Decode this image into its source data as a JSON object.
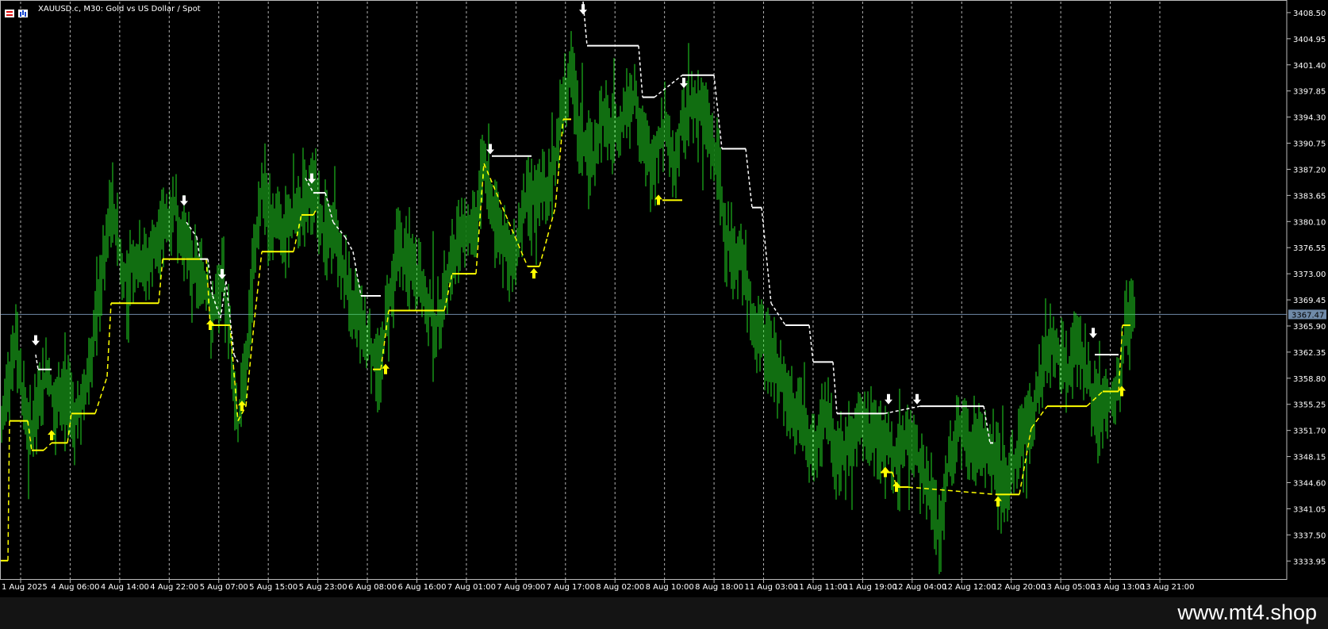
{
  "header": {
    "symbol": "XAUUSD.c, M30:",
    "description": "Gold vs US Dollar / Spot"
  },
  "watermark": "www.mt4.shop",
  "colors": {
    "background": "#000000",
    "candle": "#22dd22",
    "up_signal": "#ffff00",
    "down_signal": "#ffffff",
    "bid_line": "#6f8aa8",
    "grid": "#cfcfcf"
  },
  "chart_data": {
    "type": "bar",
    "title": "",
    "symbol": "XAUUSD.c",
    "timeframe": "M30",
    "ylim": [
      3331.5,
      3410.0
    ],
    "y_ticks": [
      "3408.50",
      "3404.95",
      "3401.40",
      "3397.85",
      "3394.30",
      "3390.75",
      "3387.20",
      "3383.65",
      "3380.10",
      "3376.55",
      "3373.00",
      "3369.45",
      "3365.90",
      "3362.35",
      "3358.80",
      "3355.25",
      "3351.70",
      "3348.15",
      "3344.60",
      "3341.05",
      "3337.50",
      "3333.95"
    ],
    "x_ticks": [
      "1 Aug 2025",
      "4 Aug 06:00",
      "4 Aug 14:00",
      "4 Aug 22:00",
      "5 Aug 07:00",
      "5 Aug 15:00",
      "5 Aug 23:00",
      "6 Aug 08:00",
      "6 Aug 16:00",
      "7 Aug 01:00",
      "7 Aug 09:00",
      "7 Aug 17:00",
      "8 Aug 02:00",
      "8 Aug 10:00",
      "8 Aug 18:00",
      "11 Aug 03:00",
      "11 Aug 11:00",
      "11 Aug 19:00",
      "12 Aug 04:00",
      "12 Aug 12:00",
      "12 Aug 20:00",
      "13 Aug 05:00",
      "13 Aug 13:00",
      "13 Aug 21:00"
    ],
    "current_price": "3367.47",
    "grid": "vertical dashed",
    "close_path": [
      [
        0,
        3350
      ],
      [
        10,
        3358
      ],
      [
        20,
        3364
      ],
      [
        30,
        3355
      ],
      [
        40,
        3352
      ],
      [
        50,
        3356
      ],
      [
        60,
        3360
      ],
      [
        70,
        3354
      ],
      [
        80,
        3358
      ],
      [
        95,
        3354
      ],
      [
        110,
        3358
      ],
      [
        125,
        3370
      ],
      [
        140,
        3384
      ],
      [
        155,
        3373
      ],
      [
        170,
        3375
      ],
      [
        185,
        3374
      ],
      [
        200,
        3378
      ],
      [
        210,
        3380
      ],
      [
        220,
        3382
      ],
      [
        230,
        3378
      ],
      [
        240,
        3375
      ],
      [
        255,
        3372
      ],
      [
        270,
        3368
      ],
      [
        280,
        3372
      ],
      [
        290,
        3365
      ],
      [
        300,
        3352
      ],
      [
        310,
        3360
      ],
      [
        320,
        3375
      ],
      [
        330,
        3385
      ],
      [
        340,
        3381
      ],
      [
        360,
        3379
      ],
      [
        380,
        3381
      ],
      [
        395,
        3384
      ],
      [
        410,
        3378
      ],
      [
        425,
        3377
      ],
      [
        440,
        3371
      ],
      [
        455,
        3366
      ],
      [
        470,
        3362
      ],
      [
        480,
        3360
      ],
      [
        490,
        3370
      ],
      [
        500,
        3377
      ],
      [
        515,
        3374
      ],
      [
        530,
        3372
      ],
      [
        550,
        3366
      ],
      [
        560,
        3370
      ],
      [
        575,
        3377
      ],
      [
        590,
        3379
      ],
      [
        600,
        3378
      ],
      [
        610,
        3388
      ],
      [
        620,
        3382
      ],
      [
        630,
        3378
      ],
      [
        645,
        3374
      ],
      [
        655,
        3379
      ],
      [
        665,
        3383
      ],
      [
        675,
        3384
      ],
      [
        690,
        3385
      ],
      [
        700,
        3389
      ],
      [
        710,
        3397
      ],
      [
        720,
        3400
      ],
      [
        730,
        3392
      ],
      [
        740,
        3390
      ],
      [
        750,
        3388
      ],
      [
        760,
        3395
      ],
      [
        770,
        3392
      ],
      [
        785,
        3394
      ],
      [
        800,
        3397
      ],
      [
        810,
        3392
      ],
      [
        820,
        3387
      ],
      [
        830,
        3391
      ],
      [
        840,
        3394
      ],
      [
        850,
        3388
      ],
      [
        860,
        3394
      ],
      [
        875,
        3396
      ],
      [
        890,
        3394
      ],
      [
        905,
        3388
      ],
      [
        915,
        3378
      ],
      [
        925,
        3376
      ],
      [
        940,
        3374
      ],
      [
        950,
        3365
      ],
      [
        965,
        3363
      ],
      [
        980,
        3361
      ],
      [
        995,
        3355
      ],
      [
        1010,
        3353
      ],
      [
        1025,
        3349
      ],
      [
        1040,
        3355
      ],
      [
        1055,
        3348
      ],
      [
        1070,
        3350
      ],
      [
        1085,
        3352
      ],
      [
        1100,
        3351
      ],
      [
        1115,
        3350
      ],
      [
        1130,
        3348
      ],
      [
        1145,
        3351
      ],
      [
        1160,
        3347
      ],
      [
        1175,
        3343
      ],
      [
        1185,
        3336
      ],
      [
        1195,
        3347
      ],
      [
        1210,
        3352
      ],
      [
        1225,
        3349
      ],
      [
        1240,
        3350
      ],
      [
        1255,
        3348
      ],
      [
        1270,
        3344
      ],
      [
        1285,
        3350
      ],
      [
        1300,
        3353
      ],
      [
        1315,
        3361
      ],
      [
        1330,
        3364
      ],
      [
        1345,
        3359
      ],
      [
        1360,
        3364
      ],
      [
        1375,
        3357
      ],
      [
        1385,
        3354
      ],
      [
        1395,
        3356
      ],
      [
        1410,
        3357
      ],
      [
        1420,
        3367
      ],
      [
        1430,
        3368
      ]
    ],
    "series": [
      {
        "values": [
          [
            0,
            3334
          ],
          [
            10,
            3334
          ],
          [
            12,
            3353
          ],
          [
            35,
            3353
          ],
          [
            40,
            3349
          ],
          [
            55,
            3349
          ],
          [
            65,
            3350
          ],
          [
            85,
            3350
          ],
          [
            90,
            3354
          ],
          [
            120,
            3354
          ],
          [
            135,
            3359
          ],
          [
            140,
            3369
          ],
          [
            200,
            3369
          ],
          [
            205,
            3375
          ],
          [
            260,
            3375
          ],
          [
            265,
            3366
          ],
          [
            290,
            3366
          ],
          [
            300,
            3353
          ],
          [
            310,
            3355
          ],
          [
            320,
            3366
          ],
          [
            330,
            3376
          ],
          [
            370,
            3376
          ],
          [
            380,
            3381
          ],
          [
            395,
            3381
          ],
          [
            400,
            3382
          ],
          [
            470,
            3360
          ],
          [
            480,
            3360
          ],
          [
            490,
            3368
          ],
          [
            560,
            3368
          ],
          [
            570,
            3373
          ],
          [
            600,
            3373
          ],
          [
            610,
            3388
          ],
          [
            665,
            3374
          ],
          [
            680,
            3374
          ],
          [
            690,
            3378
          ],
          [
            700,
            3382
          ],
          [
            710,
            3394
          ],
          [
            720,
            3394
          ],
          [
            835,
            3383
          ],
          [
            860,
            3383
          ],
          [
            1110,
            3346
          ],
          [
            1125,
            3346
          ],
          [
            1130,
            3344
          ],
          [
            1145,
            3344
          ],
          [
            1255,
            3343
          ],
          [
            1285,
            3343
          ],
          [
            1300,
            3352
          ],
          [
            1320,
            3355
          ],
          [
            1370,
            3355
          ],
          [
            1390,
            3357
          ],
          [
            1410,
            3357
          ],
          [
            1415,
            3366
          ],
          [
            1425,
            3366
          ]
        ]
      },
      {
        "values": [
          [
            45,
            3362
          ],
          [
            48,
            3360
          ],
          [
            65,
            3360
          ],
          [
            235,
            3380
          ],
          [
            248,
            3378
          ],
          [
            252,
            3375
          ],
          [
            262,
            3375
          ],
          [
            268,
            3370
          ],
          [
            278,
            3367
          ],
          [
            285,
            3372
          ],
          [
            295,
            3362
          ],
          [
            300,
            3361
          ],
          [
            385,
            3386
          ],
          [
            395,
            3384
          ],
          [
            410,
            3384
          ],
          [
            420,
            3380
          ],
          [
            435,
            3378
          ],
          [
            445,
            3376
          ],
          [
            455,
            3370
          ],
          [
            480,
            3370
          ],
          [
            620,
            3389
          ],
          [
            670,
            3389
          ],
          [
            735,
            3410
          ],
          [
            740,
            3404
          ],
          [
            805,
            3404
          ],
          [
            810,
            3397
          ],
          [
            825,
            3397
          ],
          [
            860,
            3400
          ],
          [
            900,
            3400
          ],
          [
            910,
            3390
          ],
          [
            940,
            3390
          ],
          [
            948,
            3382
          ],
          [
            960,
            3382
          ],
          [
            972,
            3369
          ],
          [
            990,
            3366
          ],
          [
            1020,
            3366
          ],
          [
            1025,
            3361
          ],
          [
            1050,
            3361
          ],
          [
            1055,
            3354
          ],
          [
            1115,
            3354
          ],
          [
            1160,
            3355
          ],
          [
            1240,
            3355
          ],
          [
            1248,
            3350
          ],
          [
            1252,
            3350
          ],
          [
            1380,
            3362
          ],
          [
            1410,
            3362
          ]
        ]
      }
    ],
    "signals": {
      "up": [
        [
          65,
          3351
        ],
        [
          265,
          3366
        ],
        [
          305,
          3355
        ],
        [
          486,
          3360
        ],
        [
          673,
          3373
        ],
        [
          830,
          3383
        ],
        [
          1116,
          3346
        ],
        [
          1130,
          3344
        ],
        [
          1258,
          3342
        ],
        [
          1414,
          3357
        ]
      ],
      "down": [
        [
          45,
          3364
        ],
        [
          232,
          3383
        ],
        [
          280,
          3373
        ],
        [
          393,
          3386
        ],
        [
          618,
          3390
        ],
        [
          735,
          3409
        ],
        [
          862,
          3399
        ],
        [
          1120,
          3356
        ],
        [
          1156,
          3356
        ],
        [
          1378,
          3365
        ]
      ]
    }
  }
}
